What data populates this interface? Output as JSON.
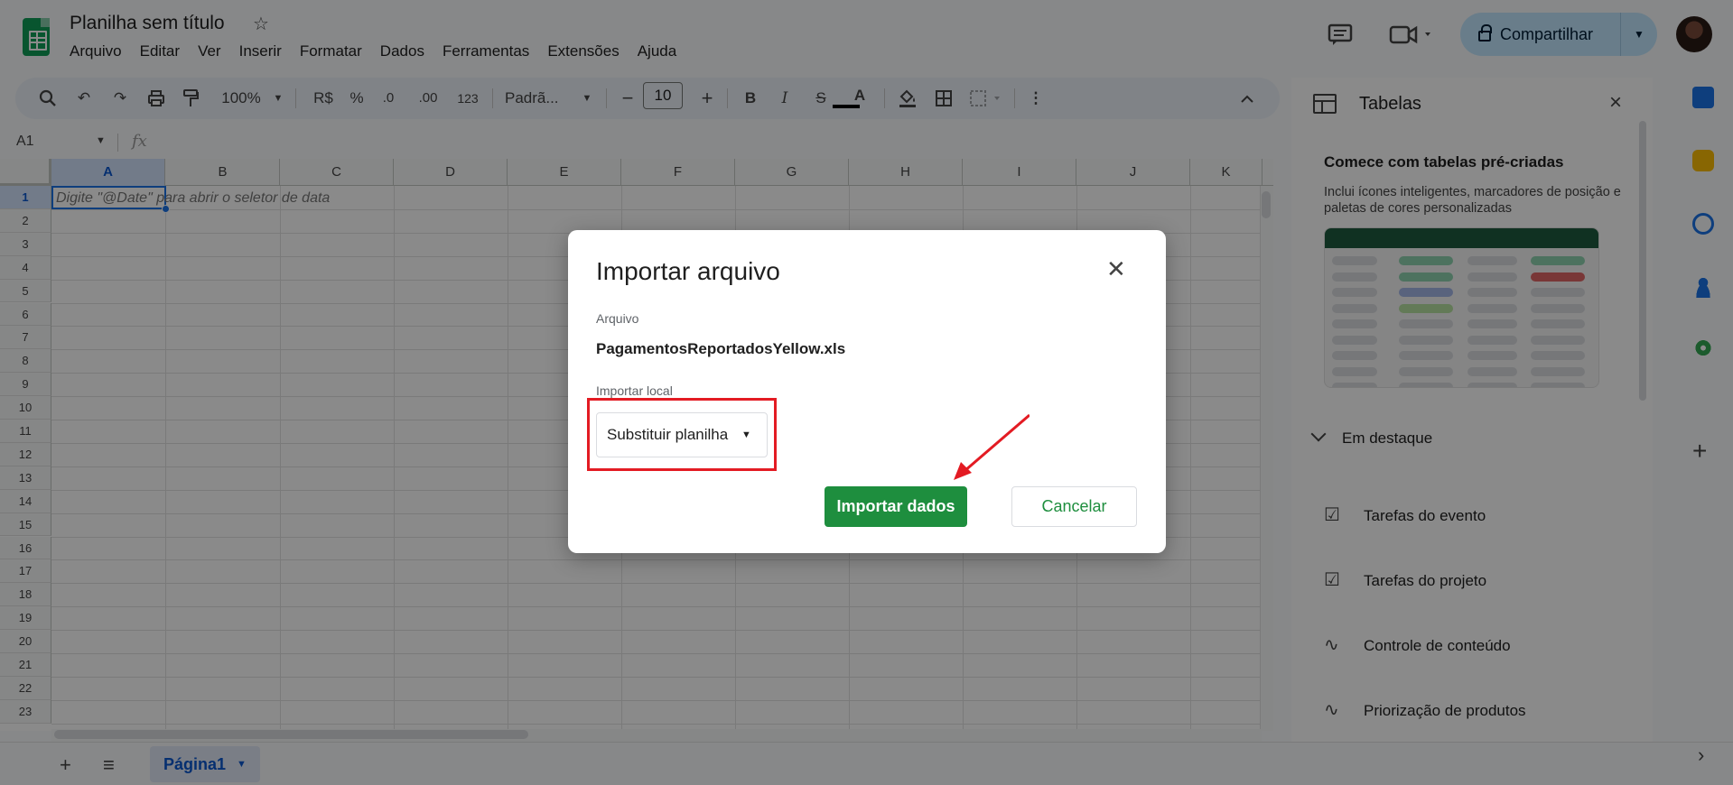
{
  "doc": {
    "title": "Planilha sem título"
  },
  "menu": [
    "Arquivo",
    "Editar",
    "Ver",
    "Inserir",
    "Formatar",
    "Dados",
    "Ferramentas",
    "Extensões",
    "Ajuda"
  ],
  "header": {
    "share_label": "Compartilhar"
  },
  "toolbar": {
    "zoom": "100%",
    "currency": "R$",
    "percent": "%",
    "dec_decrease": ".0",
    "dec_increase": ".00",
    "number_format": "123",
    "font": "Padrã...",
    "font_size": "10"
  },
  "formula": {
    "cell_ref": "A1",
    "fx": "fx"
  },
  "grid": {
    "columns": [
      "A",
      "B",
      "C",
      "D",
      "E",
      "F",
      "G",
      "H",
      "I",
      "J",
      "K"
    ],
    "rows": [
      "1",
      "2",
      "3",
      "4",
      "5",
      "6",
      "7",
      "8",
      "9",
      "10",
      "11",
      "12",
      "13",
      "14",
      "15",
      "16",
      "17",
      "18",
      "19",
      "20",
      "21",
      "22",
      "23"
    ],
    "a1_hint": "Digite \"@Date\" para abrir o seletor de data"
  },
  "sheets": [
    {
      "name": "Página1",
      "active": true
    }
  ],
  "sidepanel": {
    "title": "Tabelas",
    "section_title": "Comece com tabelas pré-criadas",
    "section_desc": "Inclui ícones inteligentes, marcadores de posição e paletas de cores personalizadas",
    "featured": "Em destaque",
    "items": [
      "Tarefas do evento",
      "Tarefas do projeto",
      "Controle de conteúdo",
      "Priorização de produtos"
    ]
  },
  "dialog": {
    "title": "Importar arquivo",
    "file_label": "Arquivo",
    "file_name": "PagamentosReportadosYellow.xls",
    "location_label": "Importar local",
    "location_value": "Substituir planilha",
    "import_button": "Importar dados",
    "cancel_button": "Cancelar"
  },
  "colors": {
    "primary_green": "#1e8e3e",
    "share_bg": "#c2e7ff",
    "highlight_red": "#e31b23",
    "selection_blue": "#1a73e8"
  }
}
